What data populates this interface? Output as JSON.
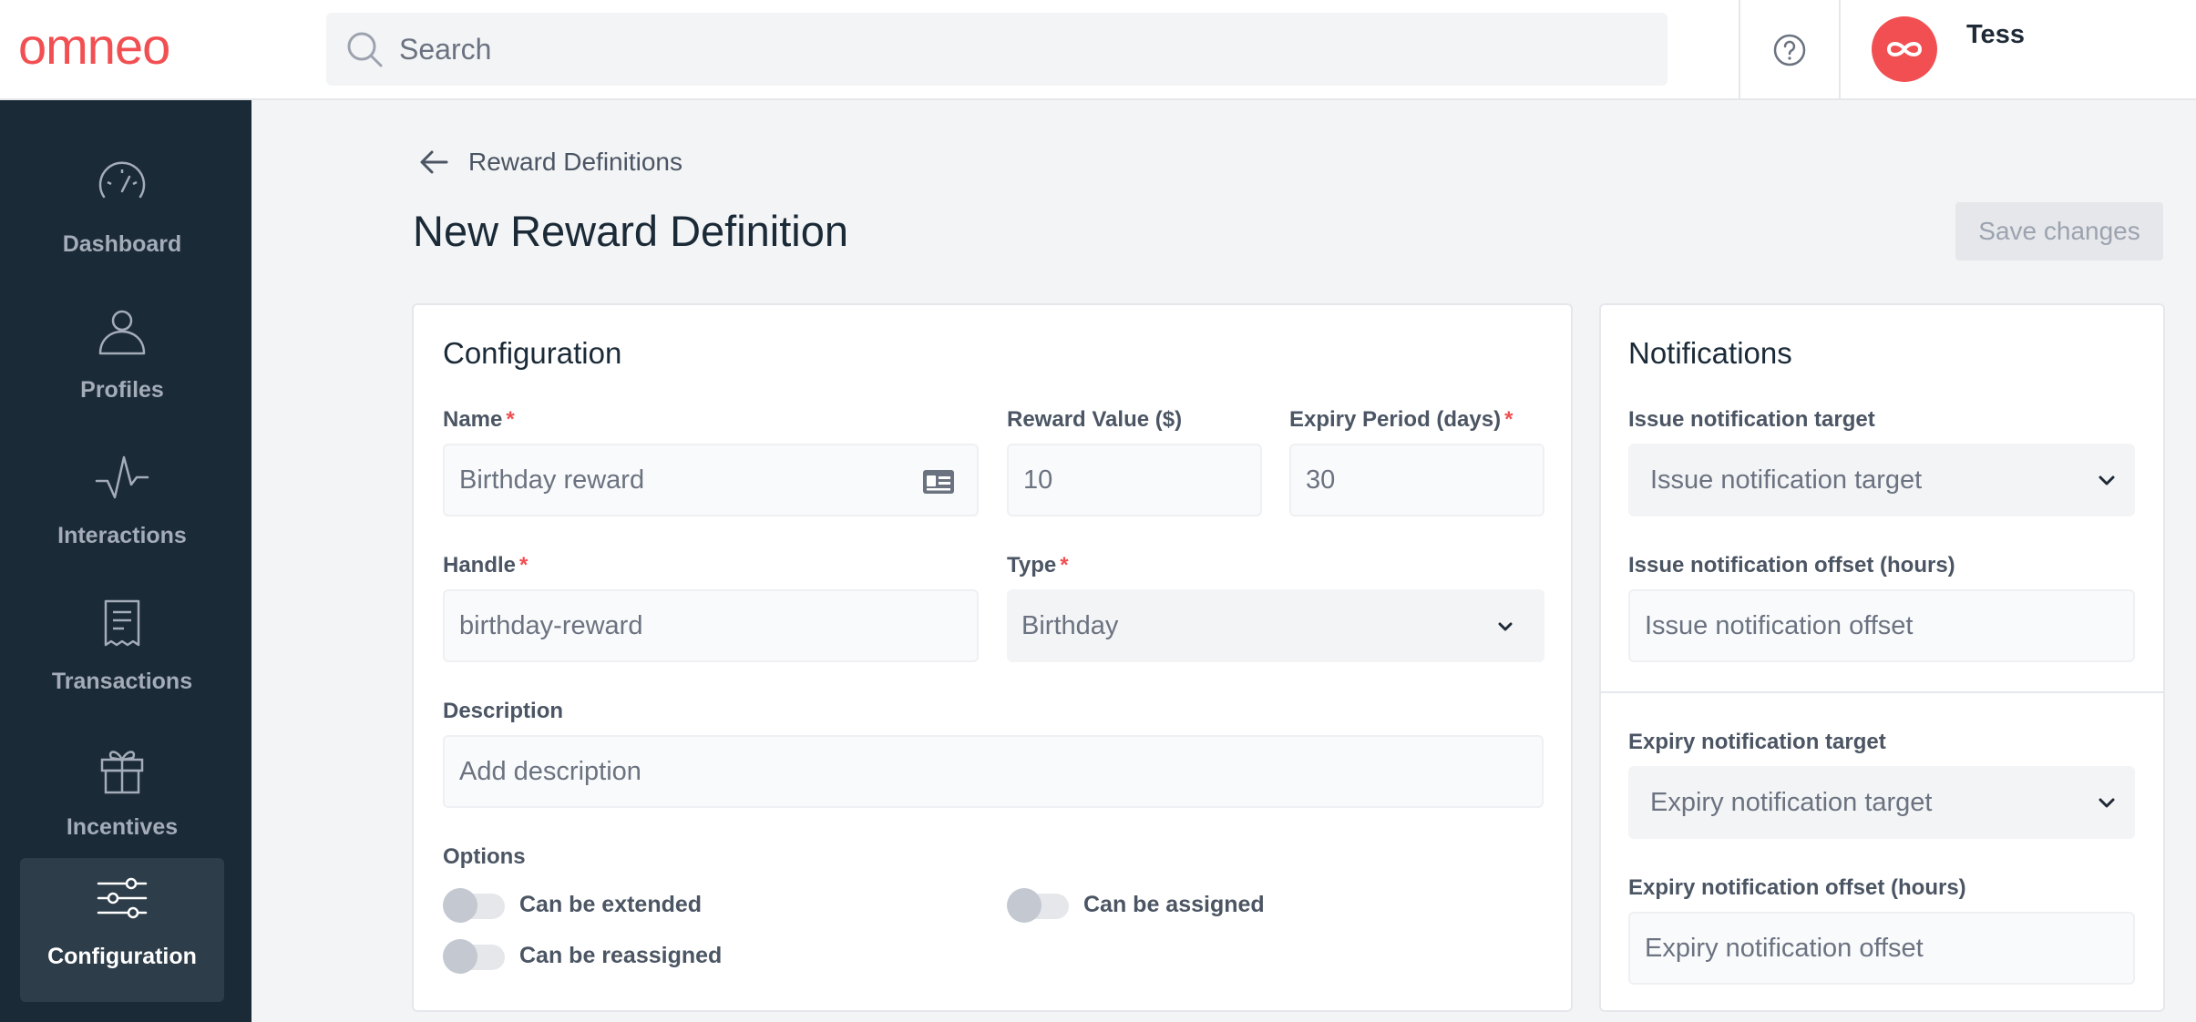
{
  "brand": {
    "logo_text": "omneo",
    "accent": "#f24f52"
  },
  "search": {
    "placeholder": "Search"
  },
  "user": {
    "name": "Tess"
  },
  "sidebar": {
    "items": [
      {
        "label": "Dashboard",
        "icon": "dashboard-icon"
      },
      {
        "label": "Profiles",
        "icon": "profile-icon"
      },
      {
        "label": "Interactions",
        "icon": "activity-icon"
      },
      {
        "label": "Transactions",
        "icon": "receipt-icon"
      },
      {
        "label": "Incentives",
        "icon": "gift-icon"
      },
      {
        "label": "Configuration",
        "icon": "sliders-icon",
        "active": true
      }
    ]
  },
  "header": {
    "back_label": "Reward Definitions",
    "title": "New Reward Definition",
    "save_label": "Save changes"
  },
  "configuration": {
    "title": "Configuration",
    "name": {
      "label": "Name",
      "required": "*",
      "placeholder": "Birthday reward"
    },
    "reward_value": {
      "label": "Reward Value ($)",
      "placeholder": "10"
    },
    "expiry_period": {
      "label": "Expiry Period (days)",
      "required": "*",
      "placeholder": "30"
    },
    "handle": {
      "label": "Handle",
      "required": "*",
      "placeholder": "birthday-reward"
    },
    "type": {
      "label": "Type",
      "required": "*",
      "value": "Birthday"
    },
    "description": {
      "label": "Description",
      "placeholder": "Add description"
    },
    "options": {
      "label": "Options",
      "can_be_extended": {
        "label": "Can be extended",
        "on": false
      },
      "can_be_assigned": {
        "label": "Can be assigned",
        "on": false
      },
      "can_be_reassigned": {
        "label": "Can be reassigned",
        "on": false
      }
    }
  },
  "notifications": {
    "title": "Notifications",
    "issue_target": {
      "label": "Issue notification target",
      "value": "Issue notification target"
    },
    "issue_offset": {
      "label": "Issue notification offset (hours)",
      "placeholder": "Issue notification offset"
    },
    "expiry_target": {
      "label": "Expiry notification target",
      "value": "Expiry notification target"
    },
    "expiry_offset": {
      "label": "Expiry notification offset (hours)",
      "placeholder": "Expiry notification offset"
    }
  }
}
